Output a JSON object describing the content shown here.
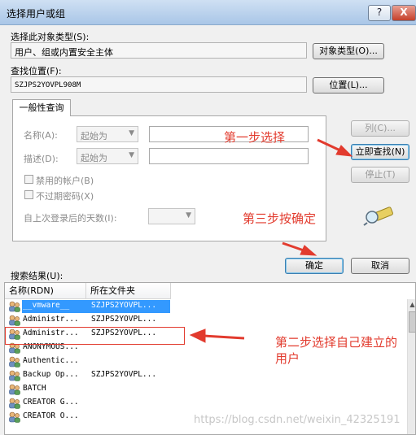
{
  "window": {
    "title": "选择用户或组",
    "help_label": "?",
    "close_label": "X"
  },
  "object_type": {
    "label": "选择此对象类型(S):",
    "value": "用户、组或内置安全主体",
    "button": "对象类型(O)..."
  },
  "location": {
    "label": "查找位置(F):",
    "value": "SZJPS2YOVPL908M",
    "button": "位置(L)..."
  },
  "general_query": {
    "tab": "一般性查询",
    "name_label": "名称(A):",
    "name_mode": "起始为",
    "desc_label": "描述(D):",
    "desc_mode": "起始为",
    "disabled_accounts": "禁用的帐户(B)",
    "no_expire_pwd": "不过期密码(X)",
    "days_since_login": "自上次登录后的天数(I):"
  },
  "side_buttons": {
    "columns": "列(C)...",
    "find_now": "立即查找(N)",
    "stop": "停止(T)"
  },
  "dialog_buttons": {
    "ok": "确定",
    "cancel": "取消"
  },
  "annotations": {
    "step1": "第一步选择",
    "step2_line1": "第二步选择自己建立的",
    "step2_line2": "用户",
    "step3": "第三步按确定"
  },
  "results": {
    "label": "搜索结果(U):",
    "columns": [
      "名称(RDN)",
      "所在文件夹"
    ],
    "rows": [
      {
        "name": "__vmware__",
        "folder": "SZJPS2YOVPL...",
        "selected": true
      },
      {
        "name": "Administr...",
        "folder": "SZJPS2YOVPL...",
        "selected": false
      },
      {
        "name": "Administr...",
        "folder": "SZJPS2YOVPL...",
        "selected": false
      },
      {
        "name": "ANONYMOUS...",
        "folder": "",
        "selected": false
      },
      {
        "name": "Authentic...",
        "folder": "",
        "selected": false
      },
      {
        "name": "Backup Op...",
        "folder": "SZJPS2YOVPL...",
        "selected": false
      },
      {
        "name": "BATCH",
        "folder": "",
        "selected": false
      },
      {
        "name": "CREATOR G...",
        "folder": "",
        "selected": false
      },
      {
        "name": "CREATOR O...",
        "folder": "",
        "selected": false
      }
    ]
  },
  "watermark": "https://blog.csdn.net/weixin_42325191",
  "colors": {
    "annotation": "#e23b2e",
    "selection": "#3399ff"
  }
}
